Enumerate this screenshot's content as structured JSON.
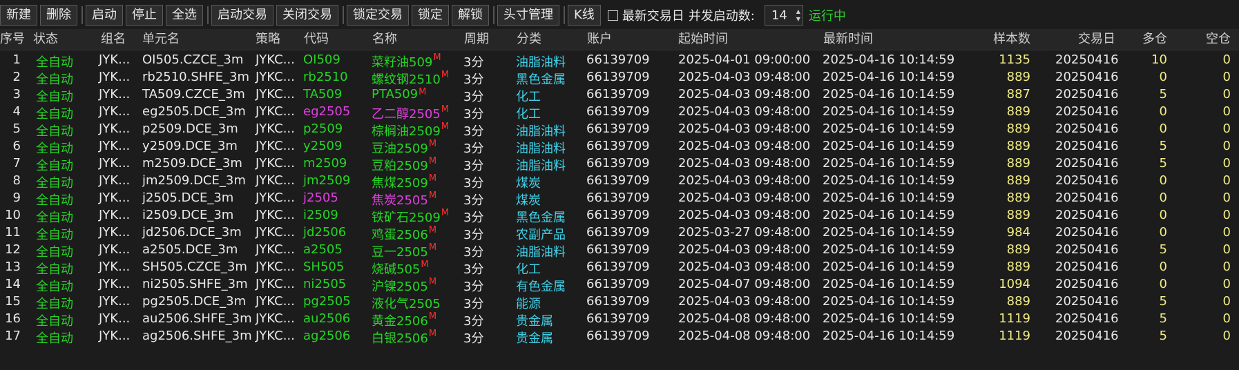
{
  "toolbar": {
    "buttons": [
      "新建",
      "删除",
      "启动",
      "停止",
      "全选",
      "启动交易",
      "关闭交易",
      "锁定交易",
      "锁定",
      "解锁",
      "头寸管理",
      "K线"
    ],
    "checkbox_label": "最新交易日",
    "concurrency_label": "并发启动数:",
    "concurrency_value": "14",
    "status": "运行中"
  },
  "columns": [
    "序号",
    "状态",
    "组名",
    "单元名",
    "策略",
    "代码",
    "名称",
    "周期",
    "分类",
    "账户",
    "起始时间",
    "最新时间",
    "样本数",
    "交易日",
    "多仓",
    "空仓"
  ],
  "rows": [
    {
      "no": "1",
      "status": "全自动",
      "group": "JYK...",
      "unit": "OI505.CZCE_3m",
      "strategy": "JYKC...",
      "code": "OI509",
      "name": "菜籽油509",
      "m": "M",
      "period": "3分",
      "category": "油脂油料",
      "account": "66139709",
      "start": "2025-04-01 09:00:00",
      "latest": "2025-04-16 10:14:59",
      "samples": "1135",
      "tday": "20250416",
      "long": "10",
      "short": "0",
      "hl": false
    },
    {
      "no": "2",
      "status": "全自动",
      "group": "JYK...",
      "unit": "rb2510.SHFE_3m",
      "strategy": "JYKC...",
      "code": "rb2510",
      "name": "螺纹钢2510",
      "m": "M",
      "period": "3分",
      "category": "黑色金属",
      "account": "66139709",
      "start": "2025-04-03 09:48:00",
      "latest": "2025-04-16 10:14:59",
      "samples": "889",
      "tday": "20250416",
      "long": "0",
      "short": "0",
      "hl": false
    },
    {
      "no": "3",
      "status": "全自动",
      "group": "JYK...",
      "unit": "TA509.CZCE_3m",
      "strategy": "JYKC...",
      "code": "TA509",
      "name": "PTA509",
      "m": "M",
      "period": "3分",
      "category": "化工",
      "account": "66139709",
      "start": "2025-04-03 09:48:00",
      "latest": "2025-04-16 10:14:59",
      "samples": "887",
      "tday": "20250416",
      "long": "5",
      "short": "0",
      "hl": false
    },
    {
      "no": "4",
      "status": "全自动",
      "group": "JYK...",
      "unit": "eg2505.DCE_3m",
      "strategy": "JYKC...",
      "code": "eg2505",
      "name": "乙二醇2505",
      "m": "M",
      "period": "3分",
      "category": "化工",
      "account": "66139709",
      "start": "2025-04-03 09:48:00",
      "latest": "2025-04-16 10:14:59",
      "samples": "889",
      "tday": "20250416",
      "long": "0",
      "short": "0",
      "hl": true
    },
    {
      "no": "5",
      "status": "全自动",
      "group": "JYK...",
      "unit": "p2509.DCE_3m",
      "strategy": "JYKC...",
      "code": "p2509",
      "name": "棕榈油2509",
      "m": "M",
      "period": "3分",
      "category": "油脂油料",
      "account": "66139709",
      "start": "2025-04-03 09:48:00",
      "latest": "2025-04-16 10:14:59",
      "samples": "889",
      "tday": "20250416",
      "long": "0",
      "short": "0",
      "hl": false
    },
    {
      "no": "6",
      "status": "全自动",
      "group": "JYK...",
      "unit": "y2509.DCE_3m",
      "strategy": "JYKC...",
      "code": "y2509",
      "name": "豆油2509",
      "m": "M",
      "period": "3分",
      "category": "油脂油料",
      "account": "66139709",
      "start": "2025-04-03 09:48:00",
      "latest": "2025-04-16 10:14:59",
      "samples": "889",
      "tday": "20250416",
      "long": "5",
      "short": "0",
      "hl": false
    },
    {
      "no": "7",
      "status": "全自动",
      "group": "JYK...",
      "unit": "m2509.DCE_3m",
      "strategy": "JYKC...",
      "code": "m2509",
      "name": "豆粕2509",
      "m": "M",
      "period": "3分",
      "category": "油脂油料",
      "account": "66139709",
      "start": "2025-04-03 09:48:00",
      "latest": "2025-04-16 10:14:59",
      "samples": "889",
      "tday": "20250416",
      "long": "5",
      "short": "0",
      "hl": false
    },
    {
      "no": "8",
      "status": "全自动",
      "group": "JYK...",
      "unit": "jm2509.DCE_3m",
      "strategy": "JYKC...",
      "code": "jm2509",
      "name": "焦煤2509",
      "m": "M",
      "period": "3分",
      "category": "煤炭",
      "account": "66139709",
      "start": "2025-04-03 09:48:00",
      "latest": "2025-04-16 10:14:59",
      "samples": "889",
      "tday": "20250416",
      "long": "0",
      "short": "0",
      "hl": false
    },
    {
      "no": "9",
      "status": "全自动",
      "group": "JYK...",
      "unit": "j2505.DCE_3m",
      "strategy": "JYKC...",
      "code": "j2505",
      "name": "焦炭2505",
      "m": "M",
      "period": "3分",
      "category": "煤炭",
      "account": "66139709",
      "start": "2025-04-03 09:48:00",
      "latest": "2025-04-16 10:14:59",
      "samples": "889",
      "tday": "20250416",
      "long": "0",
      "short": "0",
      "hl": true
    },
    {
      "no": "10",
      "status": "全自动",
      "group": "JYK...",
      "unit": "i2509.DCE_3m",
      "strategy": "JYKC...",
      "code": "i2509",
      "name": "铁矿石2509",
      "m": "M",
      "period": "3分",
      "category": "黑色金属",
      "account": "66139709",
      "start": "2025-04-03 09:48:00",
      "latest": "2025-04-16 10:14:59",
      "samples": "889",
      "tday": "20250416",
      "long": "0",
      "short": "0",
      "hl": false
    },
    {
      "no": "11",
      "status": "全自动",
      "group": "JYK...",
      "unit": "jd2506.DCE_3m",
      "strategy": "JYKC...",
      "code": "jd2506",
      "name": "鸡蛋2506",
      "m": "M",
      "period": "3分",
      "category": "农副产品",
      "account": "66139709",
      "start": "2025-03-27 09:48:00",
      "latest": "2025-04-16 10:14:59",
      "samples": "984",
      "tday": "20250416",
      "long": "0",
      "short": "0",
      "hl": false
    },
    {
      "no": "12",
      "status": "全自动",
      "group": "JYK...",
      "unit": "a2505.DCE_3m",
      "strategy": "JYKC...",
      "code": "a2505",
      "name": "豆一2505",
      "m": "M",
      "period": "3分",
      "category": "油脂油料",
      "account": "66139709",
      "start": "2025-04-03 09:48:00",
      "latest": "2025-04-16 10:14:59",
      "samples": "889",
      "tday": "20250416",
      "long": "5",
      "short": "0",
      "hl": false
    },
    {
      "no": "13",
      "status": "全自动",
      "group": "JYK...",
      "unit": "SH505.CZCE_3m",
      "strategy": "JYKC...",
      "code": "SH505",
      "name": "烧碱505",
      "m": "M",
      "period": "3分",
      "category": "化工",
      "account": "66139709",
      "start": "2025-04-03 09:48:00",
      "latest": "2025-04-16 10:14:59",
      "samples": "889",
      "tday": "20250416",
      "long": "0",
      "short": "0",
      "hl": false
    },
    {
      "no": "14",
      "status": "全自动",
      "group": "JYK...",
      "unit": "ni2505.SHFE_3m",
      "strategy": "JYKC...",
      "code": "ni2505",
      "name": "沪镍2505",
      "m": "M",
      "period": "3分",
      "category": "有色金属",
      "account": "66139709",
      "start": "2025-04-07 09:48:00",
      "latest": "2025-04-16 10:14:59",
      "samples": "1094",
      "tday": "20250416",
      "long": "0",
      "short": "0",
      "hl": false
    },
    {
      "no": "15",
      "status": "全自动",
      "group": "JYK...",
      "unit": "pg2505.DCE_3m",
      "strategy": "JYKC...",
      "code": "pg2505",
      "name": "液化气2505",
      "m": "",
      "period": "3分",
      "category": "能源",
      "account": "66139709",
      "start": "2025-04-03 09:48:00",
      "latest": "2025-04-16 10:14:59",
      "samples": "889",
      "tday": "20250416",
      "long": "5",
      "short": "0",
      "hl": false
    },
    {
      "no": "16",
      "status": "全自动",
      "group": "JYK...",
      "unit": "au2506.SHFE_3m",
      "strategy": "JYKC...",
      "code": "au2506",
      "name": "黄金2506",
      "m": "M",
      "period": "3分",
      "category": "贵金属",
      "account": "66139709",
      "start": "2025-04-08 09:48:00",
      "latest": "2025-04-16 10:14:59",
      "samples": "1119",
      "tday": "20250416",
      "long": "5",
      "short": "0",
      "hl": false
    },
    {
      "no": "17",
      "status": "全自动",
      "group": "JYK...",
      "unit": "ag2506.SHFE_3m",
      "strategy": "JYKC...",
      "code": "ag2506",
      "name": "白银2506",
      "m": "M",
      "period": "3分",
      "category": "贵金属",
      "account": "66139709",
      "start": "2025-04-08 09:48:00",
      "latest": "2025-04-16 10:14:59",
      "samples": "1119",
      "tday": "20250416",
      "long": "5",
      "short": "0",
      "hl": false
    }
  ],
  "colors": {
    "background": "#1c1c1c",
    "status_green": "#26d426",
    "highlight_magenta": "#e040e0",
    "category_cyan": "#3fd1e8",
    "number_yellow": "#f2ed84",
    "marker_red": "#ff3030"
  }
}
